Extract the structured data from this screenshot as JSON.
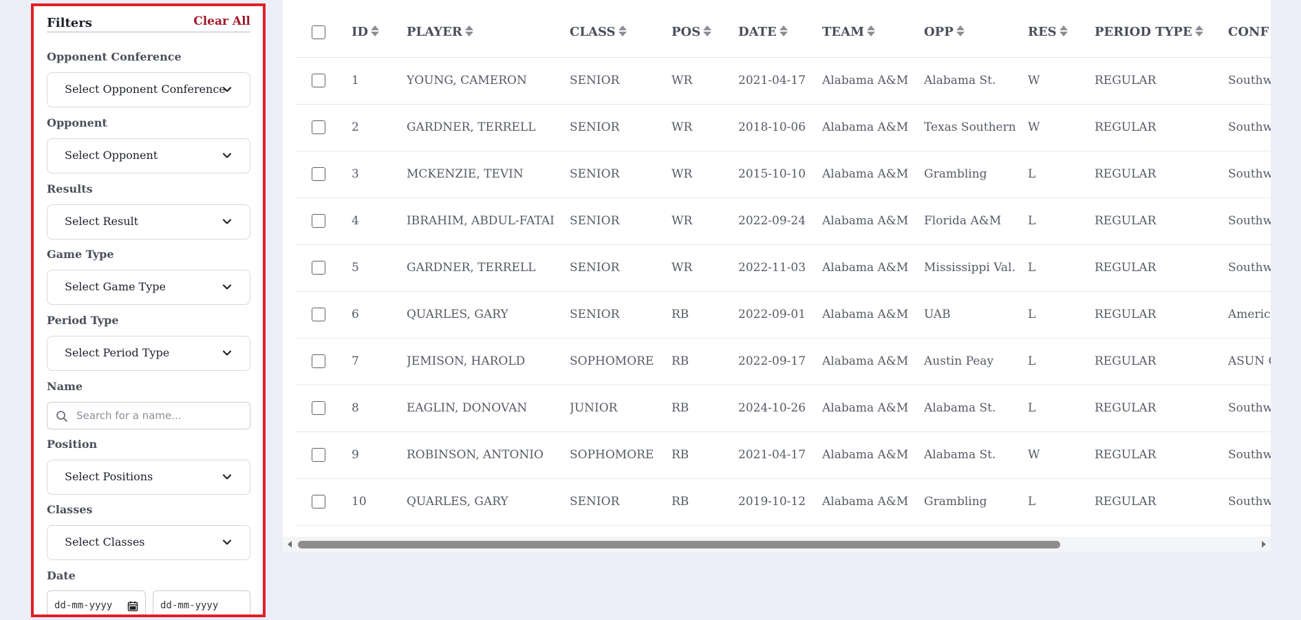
{
  "sidebar": {
    "title": "Filters",
    "clear_all": "Clear All",
    "filters": {
      "opponent_conference": {
        "label": "Opponent Conference",
        "value": "Select Opponent Conference"
      },
      "opponent": {
        "label": "Opponent",
        "value": "Select Opponent"
      },
      "results": {
        "label": "Results",
        "value": "Select Result"
      },
      "game_type": {
        "label": "Game Type",
        "value": "Select Game Type"
      },
      "period_type": {
        "label": "Period Type",
        "value": "Select Period Type"
      },
      "name": {
        "label": "Name",
        "placeholder": "Search for a name..."
      },
      "position": {
        "label": "Position",
        "value": "Select Positions"
      },
      "classes": {
        "label": "Classes",
        "value": "Select Classes"
      },
      "date": {
        "label": "Date",
        "from": "dd-mm-yyyy",
        "to": "dd-mm-yyyy"
      }
    },
    "border_color": "#e01e26",
    "accent_color": "#a0182a"
  },
  "table": {
    "columns": [
      "ID",
      "PLAYER",
      "CLASS",
      "POS",
      "DATE",
      "TEAM",
      "OPP",
      "RES",
      "PERIOD TYPE",
      "CONF"
    ],
    "rows": [
      {
        "id": "1",
        "player": "YOUNG, CAMERON",
        "class": "SENIOR",
        "pos": "WR",
        "date": "2021-04-17",
        "team": "Alabama A&M",
        "opp": "Alabama St.",
        "res": "W",
        "period": "REGULAR",
        "conf": "Southwes"
      },
      {
        "id": "2",
        "player": "GARDNER, TERRELL",
        "class": "SENIOR",
        "pos": "WR",
        "date": "2018-10-06",
        "team": "Alabama A&M",
        "opp": "Texas Southern",
        "res": "W",
        "period": "REGULAR",
        "conf": "Southwes"
      },
      {
        "id": "3",
        "player": "MCKENZIE, TEVIN",
        "class": "SENIOR",
        "pos": "WR",
        "date": "2015-10-10",
        "team": "Alabama A&M",
        "opp": "Grambling",
        "res": "L",
        "period": "REGULAR",
        "conf": "Southwes"
      },
      {
        "id": "4",
        "player": "IBRAHIM, ABDUL-FATAI",
        "class": "SENIOR",
        "pos": "WR",
        "date": "2022-09-24",
        "team": "Alabama A&M",
        "opp": "Florida A&M",
        "res": "L",
        "period": "REGULAR",
        "conf": "Southwes"
      },
      {
        "id": "5",
        "player": "GARDNER, TERRELL",
        "class": "SENIOR",
        "pos": "WR",
        "date": "2022-11-03",
        "team": "Alabama A&M",
        "opp": "Mississippi Val.",
        "res": "L",
        "period": "REGULAR",
        "conf": "Southwes"
      },
      {
        "id": "6",
        "player": "QUARLES, GARY",
        "class": "SENIOR",
        "pos": "RB",
        "date": "2022-09-01",
        "team": "Alabama A&M",
        "opp": "UAB",
        "res": "L",
        "period": "REGULAR",
        "conf": "American"
      },
      {
        "id": "7",
        "player": "JEMISON, HAROLD",
        "class": "SOPHOMORE",
        "pos": "RB",
        "date": "2022-09-17",
        "team": "Alabama A&M",
        "opp": "Austin Peay",
        "res": "L",
        "period": "REGULAR",
        "conf": "ASUN C"
      },
      {
        "id": "8",
        "player": "EAGLIN, DONOVAN",
        "class": "JUNIOR",
        "pos": "RB",
        "date": "2024-10-26",
        "team": "Alabama A&M",
        "opp": "Alabama St.",
        "res": "L",
        "period": "REGULAR",
        "conf": "Southwes"
      },
      {
        "id": "9",
        "player": "ROBINSON, ANTONIO",
        "class": "SOPHOMORE",
        "pos": "RB",
        "date": "2021-04-17",
        "team": "Alabama A&M",
        "opp": "Alabama St.",
        "res": "W",
        "period": "REGULAR",
        "conf": "Southwes"
      },
      {
        "id": "10",
        "player": "QUARLES, GARY",
        "class": "SENIOR",
        "pos": "RB",
        "date": "2019-10-12",
        "team": "Alabama A&M",
        "opp": "Grambling",
        "res": "L",
        "period": "REGULAR",
        "conf": "Southwes"
      }
    ],
    "link_color": "#2d6fd0"
  },
  "scrollbar": {
    "horizontal_position": 0
  },
  "icons": {
    "dropdown": "chevron-down-icon",
    "search": "search-icon",
    "calendar": "calendar-icon",
    "sort": "sort-icon",
    "scroll_left": "arrow-left-icon",
    "scroll_right": "arrow-right-icon"
  }
}
